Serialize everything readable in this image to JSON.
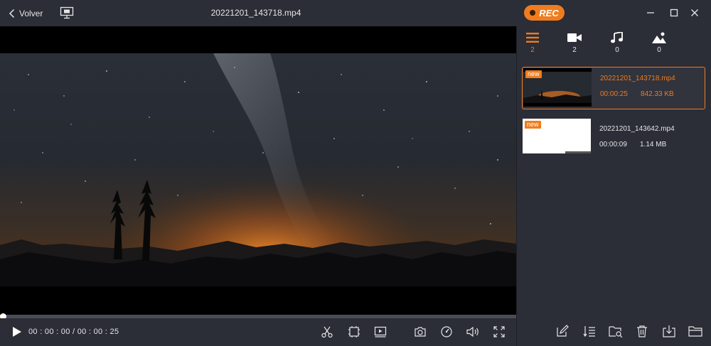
{
  "app": {
    "back_label": "Volver",
    "file_title": "20221201_143718.mp4",
    "rec_label": "REC",
    "accent_color": "#f07c1e"
  },
  "window_controls": [
    "minimize-icon",
    "maximize-icon",
    "close-icon"
  ],
  "player": {
    "time_readout": "00 : 00 : 00 / 00 : 00 : 25",
    "progress_fraction": 0.005,
    "controls": [
      "scissors-icon",
      "crop-frame-icon",
      "playback-icon",
      "camera-icon",
      "speed-icon",
      "volume-icon",
      "fullscreen-icon"
    ]
  },
  "sidebar": {
    "categories": [
      {
        "icon": "list-icon",
        "count": "2",
        "active": true
      },
      {
        "icon": "video-camera-icon",
        "count": "2",
        "active": false
      },
      {
        "icon": "music-note-icon",
        "count": "0",
        "active": false
      },
      {
        "icon": "image-icon",
        "count": "0",
        "active": false
      }
    ],
    "files": [
      {
        "badge": "new",
        "name": "20221201_143718.mp4",
        "duration": "00:00:25",
        "size": "842.33 KB",
        "selected": true
      },
      {
        "badge": "new",
        "name": "20221201_143642.mp4",
        "duration": "00:00:09",
        "size": "1.14 MB",
        "selected": false
      }
    ],
    "tools": [
      "edit-icon",
      "sort-icon",
      "search-folder-icon",
      "trash-icon",
      "import-icon",
      "folder-icon"
    ]
  }
}
